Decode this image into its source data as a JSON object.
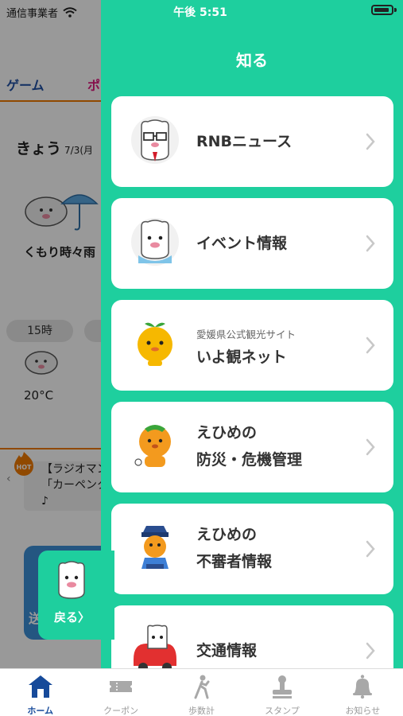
{
  "status": {
    "carrier": "通信事業者",
    "time": "午後 5:51"
  },
  "home": {
    "tabs": [
      "ゲーム",
      "ポ"
    ],
    "today_label": "きょう",
    "today_date": "7/3(月",
    "weather": "くもり時々雨",
    "hour": "15時",
    "temp": "20°C",
    "hot_badge": "HOT",
    "news_text": "【ラジオマン\n「カーペンタ\n♪",
    "card_text": "送"
  },
  "back_button": {
    "label": "戻る〉"
  },
  "drawer": {
    "title": "知る",
    "items": [
      {
        "title": "RNBニュース",
        "subtitle": "",
        "icon": "rnb-news-mascot-icon"
      },
      {
        "title": "イベント情報",
        "subtitle": "",
        "icon": "event-mascot-icon"
      },
      {
        "title": "いよ観ネット",
        "subtitle": "愛媛県公式観光サイト",
        "icon": "mican-mascot-icon"
      },
      {
        "title": "えひめの\n防災・危機管理",
        "subtitle": "",
        "icon": "disaster-mascot-icon"
      },
      {
        "title": "えひめの\n不審者情報",
        "subtitle": "",
        "icon": "police-mascot-icon"
      },
      {
        "title": "交通情報",
        "subtitle": "",
        "icon": "traffic-mascot-icon"
      }
    ]
  },
  "tabbar": {
    "active": "ホーム",
    "items": [
      {
        "label": "ホーム",
        "icon": "home-icon"
      },
      {
        "label": "クーポン",
        "icon": "coupon-icon"
      },
      {
        "label": "歩数計",
        "icon": "walker-icon"
      },
      {
        "label": "スタンプ",
        "icon": "stamp-icon"
      },
      {
        "label": "お知らせ",
        "icon": "bell-icon"
      }
    ]
  },
  "colors": {
    "drawer": "#1ecf9e",
    "active_tab": "#164a9a",
    "accent_orange": "#f07a00"
  }
}
